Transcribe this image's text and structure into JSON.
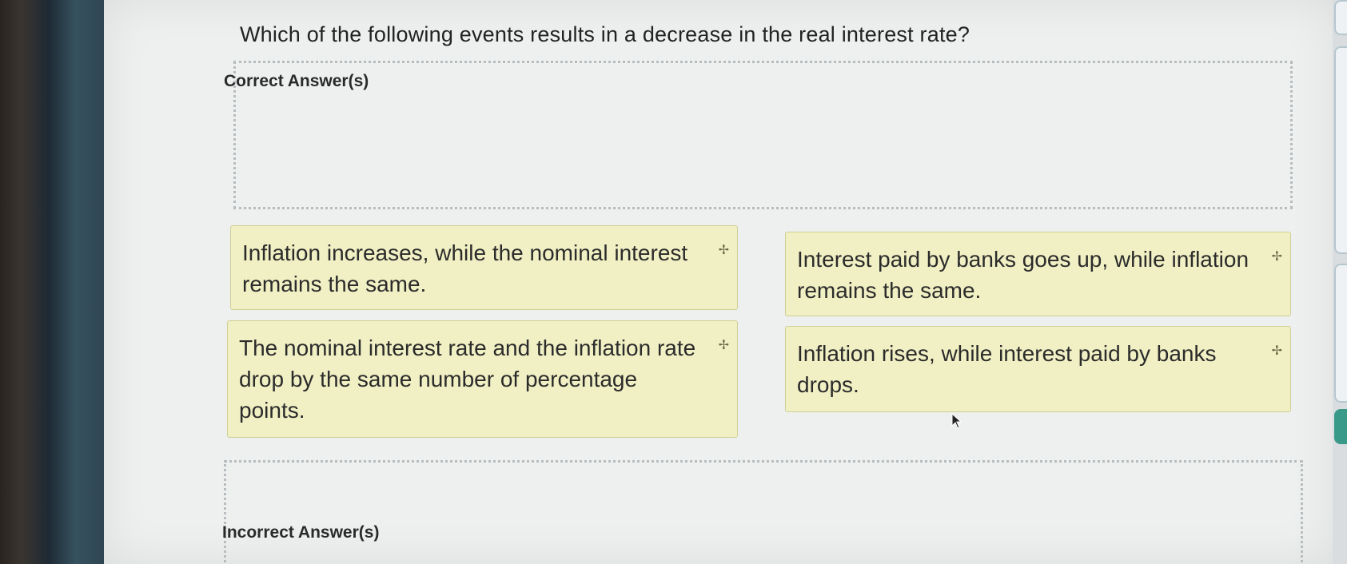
{
  "question": "Which of the following events results in a decrease in the real interest rate?",
  "zones": {
    "correct_label": "Correct Answer(s)",
    "incorrect_label": "Incorrect Answer(s)"
  },
  "cards": [
    {
      "text": "Inflation increases, while the nominal interest remains the same.",
      "icon": "drag-handle-icon"
    },
    {
      "text": "Interest paid by banks goes up, while inflation remains the same.",
      "icon": "drag-handle-icon"
    },
    {
      "text": "The nominal interest rate and the inflation rate drop by the same number of percentage points.",
      "icon": "drag-handle-icon"
    },
    {
      "text": "Inflation rises, while interest paid by banks drops.",
      "icon": "drag-handle-icon"
    }
  ],
  "colors": {
    "card_background": "#f1f0c4",
    "card_border": "#cfcf95",
    "page_background": "#eef0f0",
    "dropzone_border": "#b7bcbf"
  }
}
